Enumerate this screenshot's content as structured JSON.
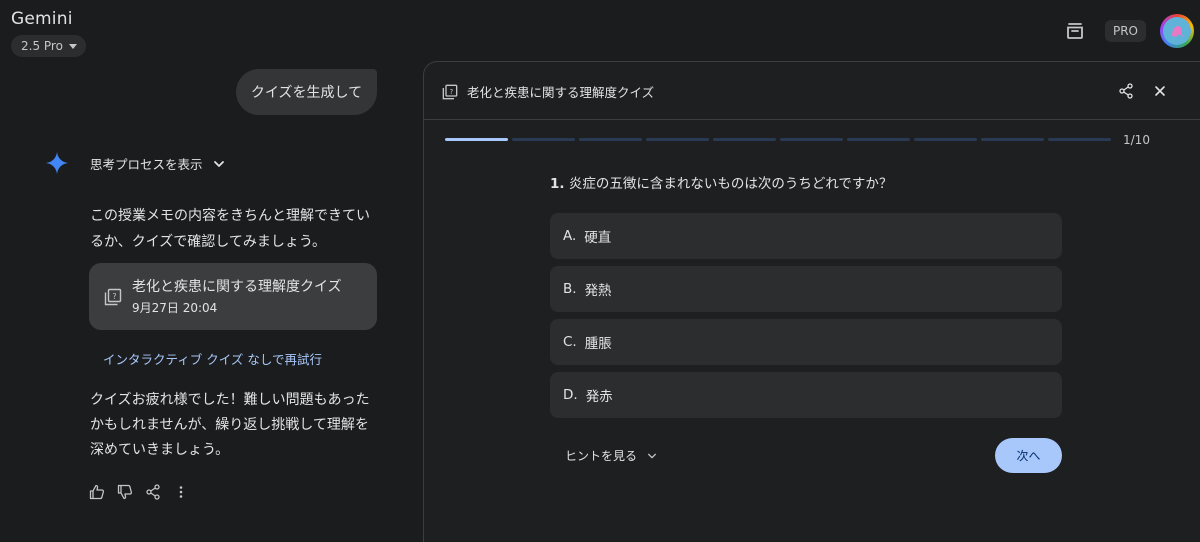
{
  "app": {
    "title": "Gemini",
    "model": "2.5 Pro",
    "pro_badge": "PRO"
  },
  "chat": {
    "user_message": "クイズを生成して",
    "thinking_label": "思考プロセスを表示",
    "reply_1_line_1": "この授業メモの内容をきちんと理解できてい",
    "reply_1_line_2": "るか、クイズで確認してみましょう。",
    "quiz_card": {
      "title": "老化と疾患に関する理解度クイズ",
      "date": "9月27日 20:04"
    },
    "retry_link": "インタラクティブ クイズ なしで再試行",
    "reply_2_line_1": "クイズお疲れ様でした！難しい問題もあった",
    "reply_2_line_2": "かもしれませんが、繰り返し挑戦して理解を",
    "reply_2_line_3": "深めていきましょう。"
  },
  "quiz": {
    "title": "老化と疾患に関する理解度クイズ",
    "progress_label": "1/10",
    "progress_current": 1,
    "progress_total": 10,
    "question_number": "1.",
    "question_text": "炎症の五徴に含まれないものは次のうちどれですか？",
    "options": [
      {
        "letter": "A.",
        "text": "硬直"
      },
      {
        "letter": "B.",
        "text": "発熱"
      },
      {
        "letter": "C.",
        "text": "腫脹"
      },
      {
        "letter": "D.",
        "text": "発赤"
      }
    ],
    "hint_label": "ヒントを見る",
    "next_label": "次へ"
  },
  "colors": {
    "background": "#1b1c1d",
    "panel": "#1e1f20",
    "accent": "#a8c7fa",
    "sparkle": "#4285f4"
  }
}
